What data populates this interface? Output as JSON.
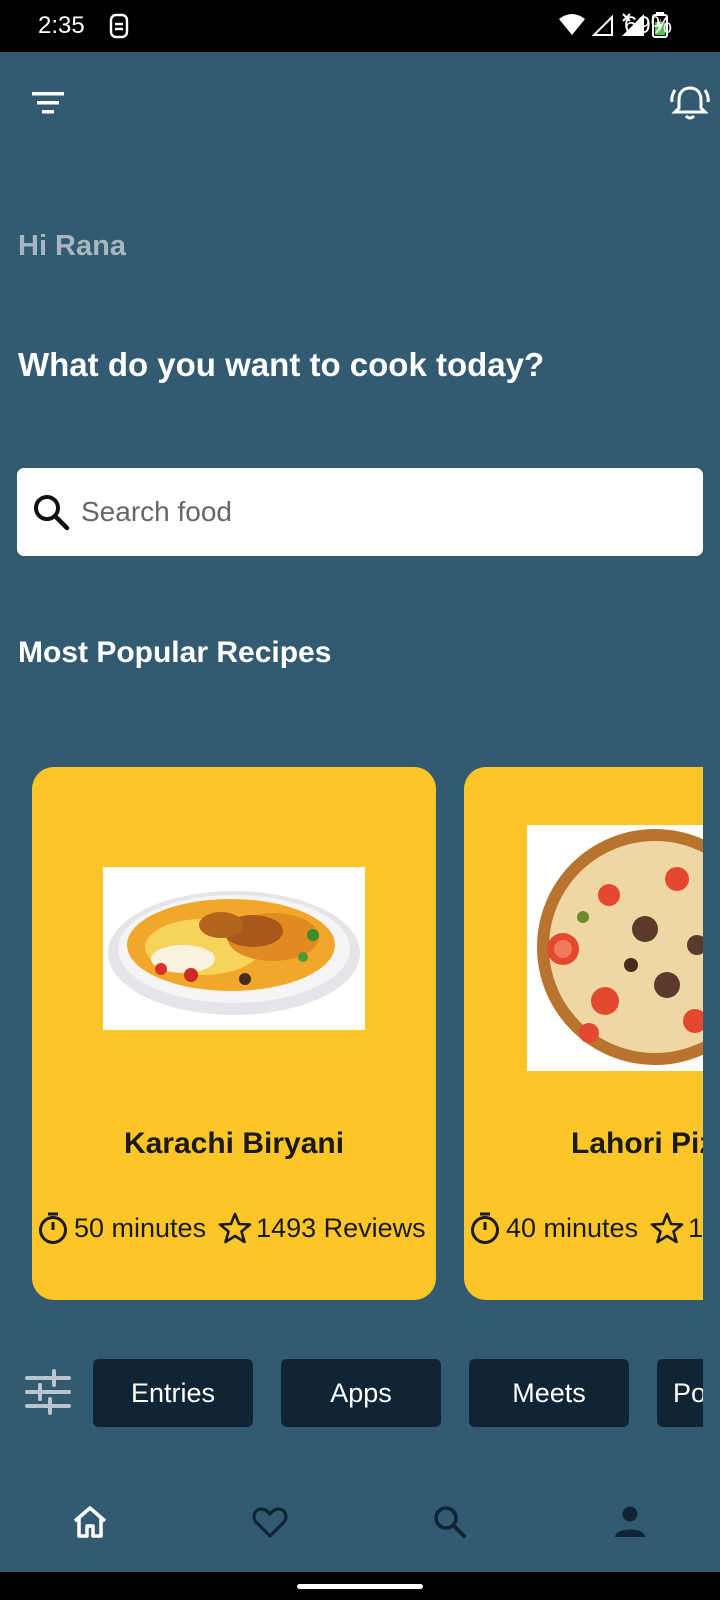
{
  "status_bar": {
    "time": "2:35",
    "battery": "69%"
  },
  "header": {
    "menu_icon": "menu-icon",
    "notification_icon": "bell-icon"
  },
  "greeting": "Hi Rana",
  "headline": "What do you want to cook today?",
  "search": {
    "placeholder": "Search food",
    "value": ""
  },
  "popular": {
    "title": "Most Popular Recipes",
    "recipes": [
      {
        "name": "Karachi Biryani",
        "time": "50 minutes",
        "reviews": "1493 Reviews"
      },
      {
        "name": "Lahori Piz",
        "time": "40 minutes",
        "reviews": "1"
      }
    ]
  },
  "chips": [
    {
      "label": "Entries"
    },
    {
      "label": "Apps"
    },
    {
      "label": "Meets"
    },
    {
      "label": "Po"
    }
  ],
  "bottom_nav": [
    "home-icon",
    "heart-icon",
    "search-icon",
    "person-icon"
  ],
  "colors": {
    "background": "#325a70",
    "card": "#fdc628",
    "chip": "#0f2535",
    "greeting": "#a9b6bf"
  }
}
